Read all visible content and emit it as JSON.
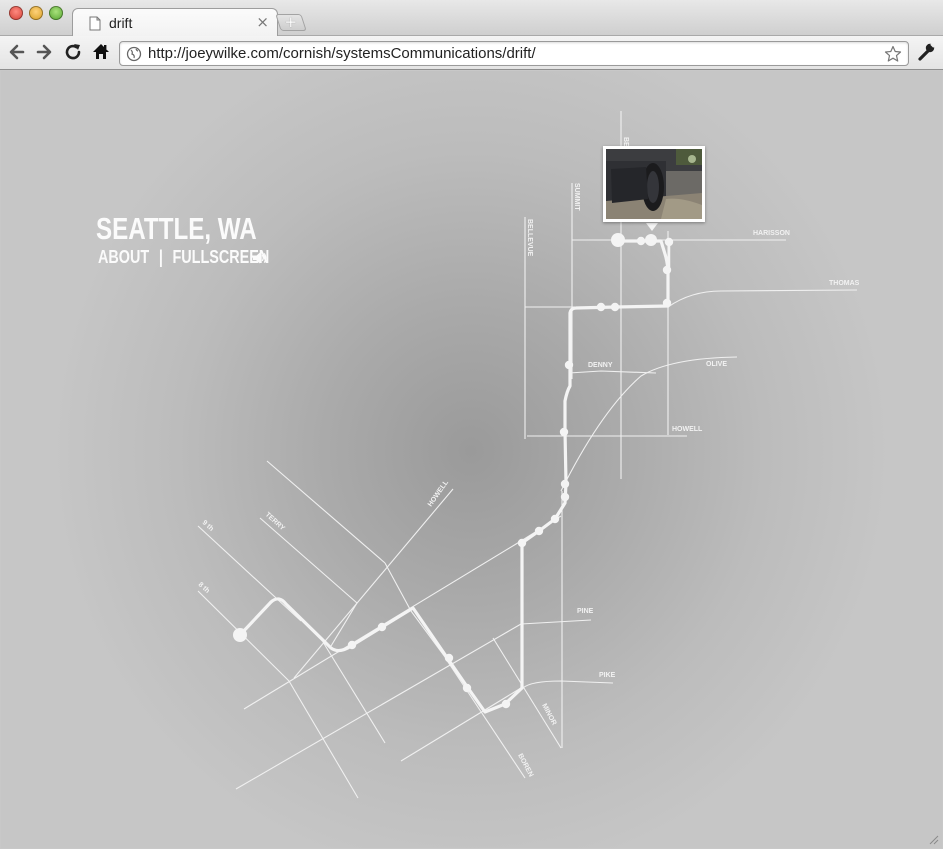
{
  "browser": {
    "tab_title": "drift",
    "new_tab_label": "+",
    "close_label": "×",
    "url": "http://joeywilke.com/cornish/systemsCommunications/drift/"
  },
  "page": {
    "city_title": "SEATTLE, WA",
    "nav_about": "ABOUT",
    "nav_separator": "|",
    "nav_fullscreen": "FULLSCREEN"
  },
  "map": {
    "street_labels": [
      "BELMONT",
      "SUMMIT",
      "BELLEVUE",
      "HARISSON",
      "THOMAS",
      "DENNY",
      "OLIVE",
      "HOWELL",
      "HOWELL",
      "TERRY",
      "9 th",
      "8 th",
      "PINE",
      "PIKE",
      "MINOR",
      "BOREN"
    ],
    "route_points": 18
  },
  "colors": {
    "map_line": "#f0f0f0",
    "route": "#f4f4f4",
    "page_bg_center": "#9a9a9a",
    "page_bg_edge": "#c6c6c6"
  }
}
